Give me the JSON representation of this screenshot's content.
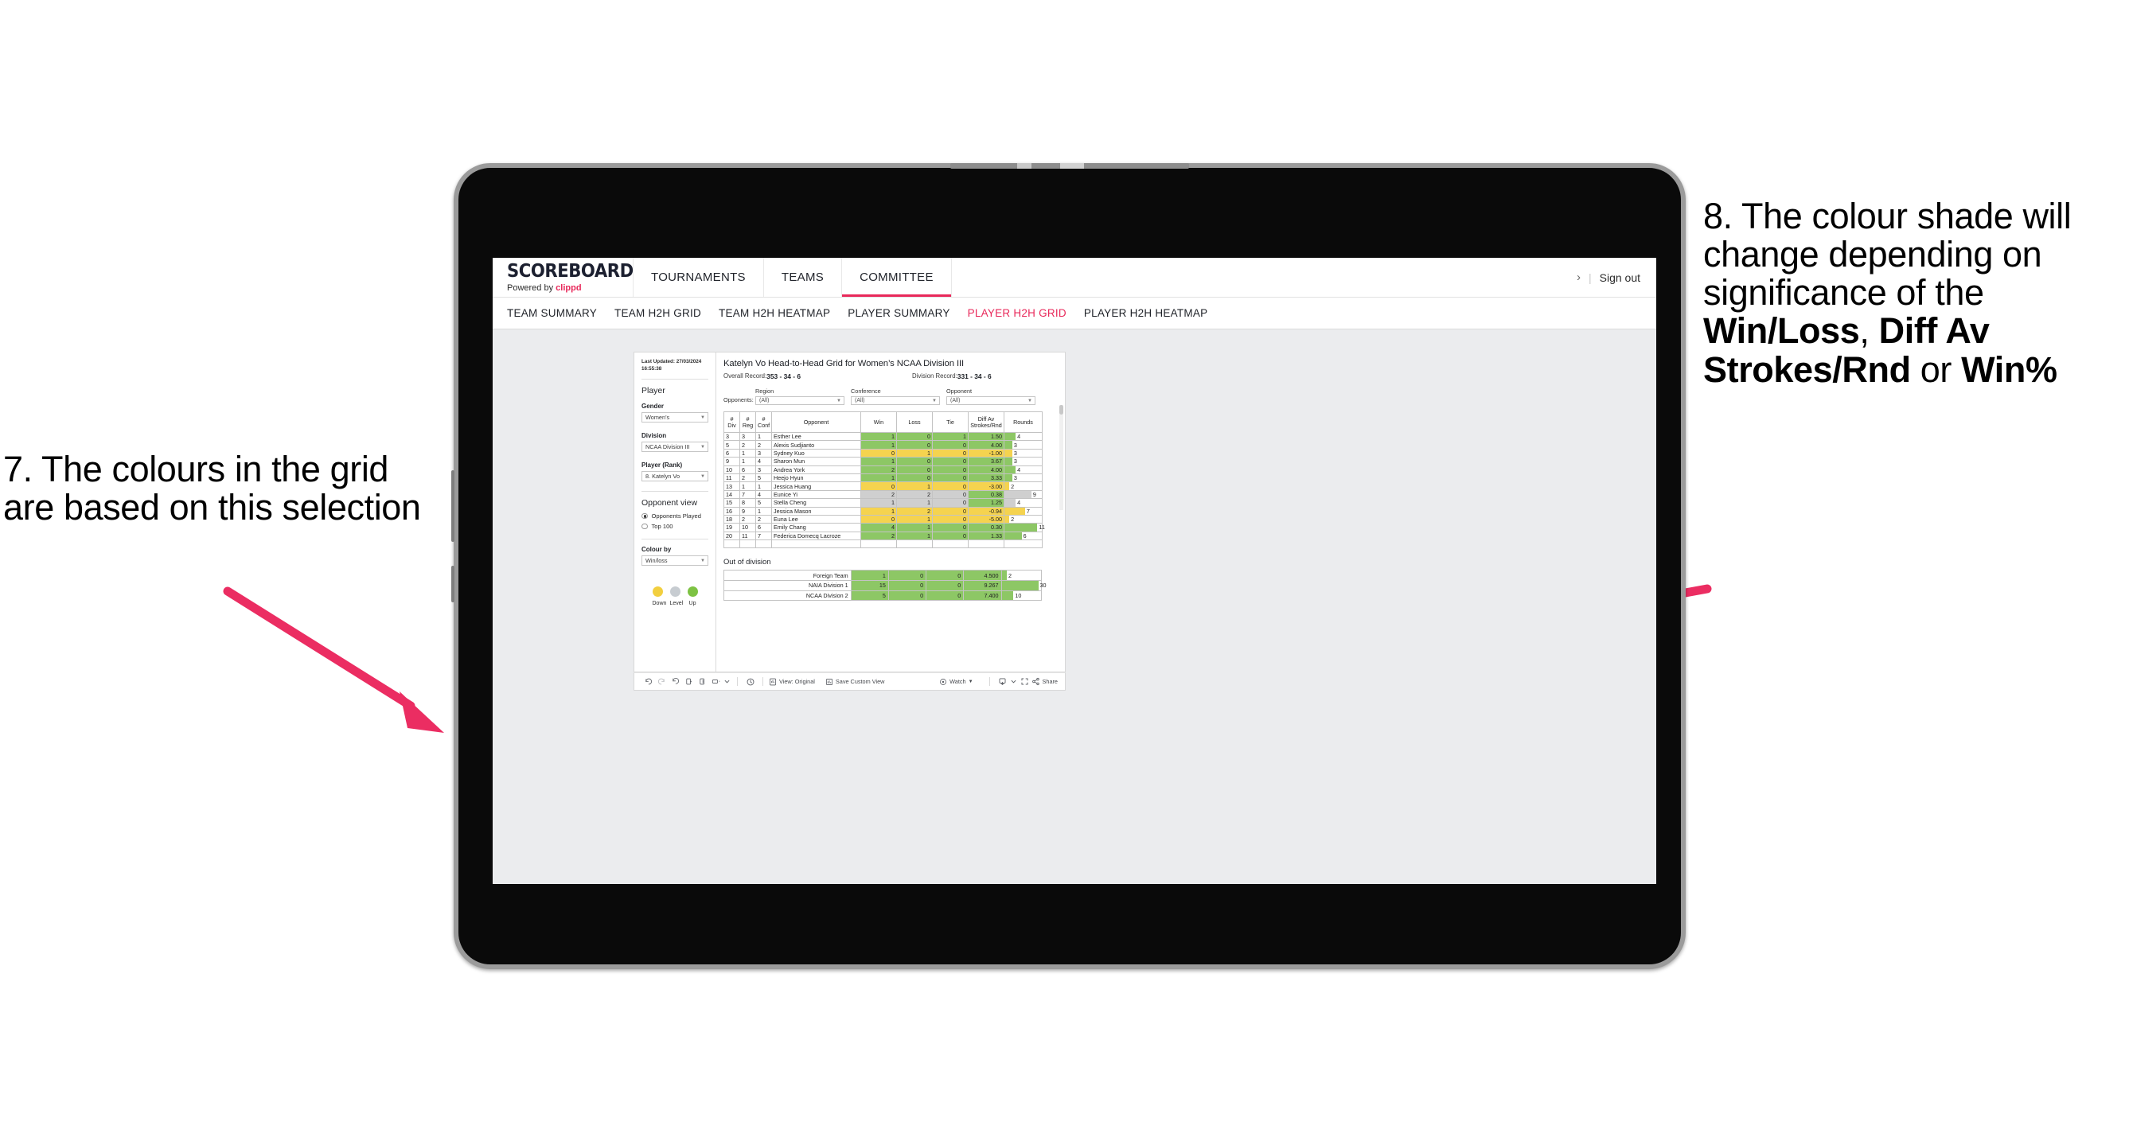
{
  "annotations": {
    "left": {
      "text": "7. The colours in the grid are based on this selection"
    },
    "right": {
      "line1": "8. The colour shade will change depending on significance of the ",
      "bold1": "Win/Loss",
      "mid1": ", ",
      "bold2": "Diff Av Strokes/Rnd",
      "mid2": " or ",
      "bold3": "Win%"
    },
    "arrow_color": "#eb2d62"
  },
  "app": {
    "logo": {
      "word": "SCOREBOARD",
      "powered_prefix": "Powered by ",
      "brand": "clippd"
    },
    "nav_tabs": [
      {
        "label": "TOURNAMENTS",
        "active": false
      },
      {
        "label": "TEAMS",
        "active": false
      },
      {
        "label": "COMMITTEE",
        "active": true
      }
    ],
    "account": {
      "chevron": "›",
      "divider": "|",
      "sign_out": "Sign out"
    },
    "sub_tabs": [
      {
        "label": "TEAM SUMMARY",
        "active": false
      },
      {
        "label": "TEAM H2H GRID",
        "active": false
      },
      {
        "label": "TEAM H2H HEATMAP",
        "active": false
      },
      {
        "label": "PLAYER SUMMARY",
        "active": false
      },
      {
        "label": "PLAYER H2H GRID",
        "active": true
      },
      {
        "label": "PLAYER H2H HEATMAP",
        "active": false
      }
    ]
  },
  "sidebar": {
    "last_updated": "Last Updated: 27/03/2024 16:55:38",
    "player_heading": "Player",
    "fields": [
      {
        "label": "Gender",
        "value": "Women’s"
      },
      {
        "label": "Division",
        "value": "NCAA Division III"
      },
      {
        "label": "Player (Rank)",
        "value": "8. Katelyn Vo"
      }
    ],
    "opponent_view": {
      "heading": "Opponent view",
      "options": [
        {
          "label": "Opponents Played",
          "selected": true
        },
        {
          "label": "Top 100",
          "selected": false
        }
      ]
    },
    "colour_by": {
      "label": "Colour by",
      "value": "Win/loss"
    },
    "legend": [
      {
        "label": "Down",
        "color": "#f2cf3f"
      },
      {
        "label": "Level",
        "color": "#c7ccd1"
      },
      {
        "label": "Up",
        "color": "#7dc243"
      }
    ]
  },
  "viz": {
    "title": "Katelyn Vo Head-to-Head Grid for Women’s NCAA Division III",
    "overall_record": {
      "label": "Overall Record: ",
      "value": "353 -  34 - 6"
    },
    "division_record": {
      "label": "Division Record: ",
      "value": "331 -  34 - 6"
    },
    "opponents_label": "Opponents:",
    "filters": [
      {
        "label": "Region",
        "value": "(All)"
      },
      {
        "label": "Conference",
        "value": "(All)"
      },
      {
        "label": "Opponent",
        "value": "(All)"
      }
    ],
    "columns": [
      {
        "l1": "#",
        "l2": "Div"
      },
      {
        "l1": "#",
        "l2": "Reg"
      },
      {
        "l1": "#",
        "l2": "Conf"
      },
      {
        "l1": "Opponent",
        "l2": ""
      },
      {
        "l1": "Win",
        "l2": ""
      },
      {
        "l1": "Loss",
        "l2": ""
      },
      {
        "l1": "Tie",
        "l2": ""
      },
      {
        "l1": "Diff Av",
        "l2": "Strokes/Rnd"
      },
      {
        "l1": "Rounds",
        "l2": ""
      }
    ],
    "rows": [
      {
        "div": "3",
        "reg": "3",
        "conf": "1",
        "opponent": "Esther Lee",
        "win": "1",
        "loss": "0",
        "tie": "1",
        "diff": "1.50",
        "rounds": "4",
        "shade": "g",
        "bar": 30
      },
      {
        "div": "5",
        "reg": "2",
        "conf": "2",
        "opponent": "Alexis Sudjianto",
        "win": "1",
        "loss": "0",
        "tie": "0",
        "diff": "4.00",
        "rounds": "3",
        "shade": "g",
        "bar": 21
      },
      {
        "div": "6",
        "reg": "1",
        "conf": "3",
        "opponent": "Sydney Kuo",
        "win": "0",
        "loss": "1",
        "tie": "0",
        "diff": "-1.00",
        "rounds": "3",
        "shade": "y",
        "bar": 21
      },
      {
        "div": "9",
        "reg": "1",
        "conf": "4",
        "opponent": "Sharon Mun",
        "win": "1",
        "loss": "0",
        "tie": "0",
        "diff": "3.67",
        "rounds": "3",
        "shade": "g",
        "bar": 21
      },
      {
        "div": "10",
        "reg": "6",
        "conf": "3",
        "opponent": "Andrea York",
        "win": "2",
        "loss": "0",
        "tie": "0",
        "diff": "4.00",
        "rounds": "4",
        "shade": "g",
        "bar": 30
      },
      {
        "div": "11",
        "reg": "2",
        "conf": "5",
        "opponent": "Heejo Hyun",
        "win": "1",
        "loss": "0",
        "tie": "0",
        "diff": "3.33",
        "rounds": "3",
        "shade": "g",
        "bar": 21
      },
      {
        "div": "13",
        "reg": "1",
        "conf": "1",
        "opponent": "Jessica Huang",
        "win": "0",
        "loss": "1",
        "tie": "0",
        "diff": "-3.00",
        "rounds": "2",
        "shade": "y",
        "bar": 13
      },
      {
        "div": "14",
        "reg": "7",
        "conf": "4",
        "opponent": "Eunice Yi",
        "win": "2",
        "loss": "2",
        "tie": "0",
        "diff": "0.38",
        "rounds": "9",
        "shade": "gr",
        "bar": 72,
        "diff_shade": "g"
      },
      {
        "div": "15",
        "reg": "8",
        "conf": "5",
        "opponent": "Stella Cheng",
        "win": "1",
        "loss": "1",
        "tie": "0",
        "diff": "1.25",
        "rounds": "4",
        "shade": "gr",
        "bar": 30,
        "diff_shade": "g"
      },
      {
        "div": "16",
        "reg": "9",
        "conf": "1",
        "opponent": "Jessica Mason",
        "win": "1",
        "loss": "2",
        "tie": "0",
        "diff": "-0.94",
        "rounds": "7",
        "shade": "y",
        "bar": 55
      },
      {
        "div": "18",
        "reg": "2",
        "conf": "2",
        "opponent": "Euna Lee",
        "win": "0",
        "loss": "1",
        "tie": "0",
        "diff": "-5.00",
        "rounds": "2",
        "shade": "y",
        "bar": 13
      },
      {
        "div": "19",
        "reg": "10",
        "conf": "6",
        "opponent": "Emily Chang",
        "win": "4",
        "loss": "1",
        "tie": "0",
        "diff": "0.30",
        "rounds": "11",
        "shade": "g",
        "bar": 88
      },
      {
        "div": "20",
        "reg": "11",
        "conf": "7",
        "opponent": "Federica Domecq Lacroze",
        "win": "2",
        "loss": "1",
        "tie": "0",
        "diff": "1.33",
        "rounds": "6",
        "shade": "g",
        "bar": 46
      }
    ],
    "out_of_division": {
      "title": "Out of division",
      "rows": [
        {
          "name": "Foreign Team",
          "win": "1",
          "loss": "0",
          "tie": "0",
          "diff": "4.500",
          "rounds": "2",
          "shade": "g",
          "bar": 13
        },
        {
          "name": "NAIA Division 1",
          "win": "15",
          "loss": "0",
          "tie": "0",
          "diff": "9.267",
          "rounds": "30",
          "shade": "g",
          "bar": 93
        },
        {
          "name": "NCAA Division 2",
          "win": "5",
          "loss": "0",
          "tie": "0",
          "diff": "7.400",
          "rounds": "10",
          "shade": "g",
          "bar": 30
        }
      ]
    }
  },
  "toolbar": {
    "view_label": "View: Original",
    "save_label": "Save Custom View",
    "watch_label": "Watch",
    "share_label": "Share"
  }
}
